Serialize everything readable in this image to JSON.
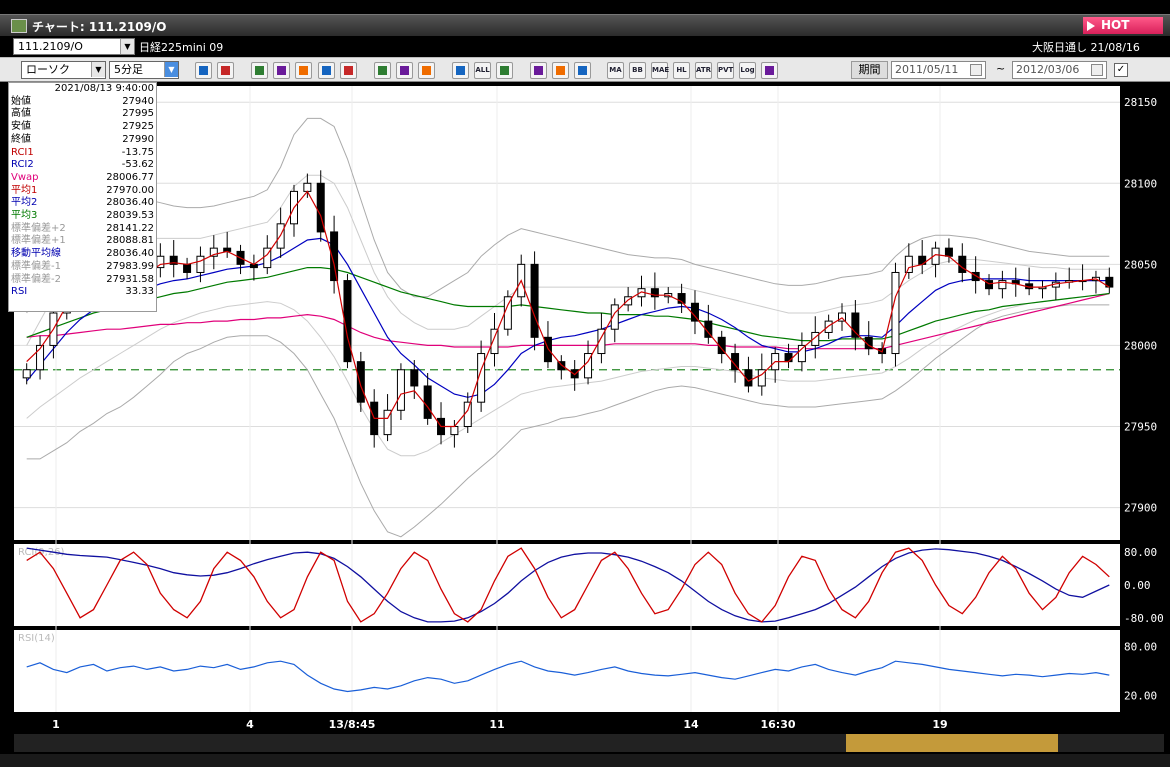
{
  "window": {
    "title": "チャート: 111.2109/O",
    "hot_label": "HOT"
  },
  "symbol_bar": {
    "symbol_code": "111.2109/O",
    "symbol_name": "日経225mini 09",
    "market_info": "大阪日通し  21/08/16"
  },
  "toolbar": {
    "chart_type": "ローソク",
    "interval": "5分足",
    "period_label": "期間",
    "date_from": "2011/05/11",
    "date_to": "2012/03/06",
    "tilde": "~",
    "icons": [
      "zoom-icon",
      "crosshair-icon",
      "down-arrow-icon",
      "zoom-in-icon",
      "grid-icon",
      "draw-icon",
      "pencil-icon",
      "cursor-icon",
      "pen-icon",
      "candle-icon",
      "candle-add-icon",
      "all-icon",
      "settings-icon",
      "brush-icon",
      "color-icon",
      "sma-icon",
      "ma-icon",
      "bb-icon",
      "mae-icon",
      "hl-icon",
      "atr-icon",
      "pivot-icon",
      "log-icon",
      "export-icon"
    ],
    "tb_labels": {
      "ma": "MA",
      "bb": "BB",
      "mae": "MAE",
      "hl": "HL",
      "atr": "ATR",
      "pvt": "PVT",
      "log": "Log",
      "all": "ALL"
    }
  },
  "info_panel": {
    "datetime": "2021/08/13 9:40:00",
    "rows": [
      {
        "label": "始値",
        "value": "27940",
        "color": "#000"
      },
      {
        "label": "高値",
        "value": "27995",
        "color": "#000"
      },
      {
        "label": "安値",
        "value": "27925",
        "color": "#000"
      },
      {
        "label": "終値",
        "value": "27990",
        "color": "#000"
      },
      {
        "label": "RCI1",
        "value": "-13.75",
        "color": "#c00000"
      },
      {
        "label": "RCI2",
        "value": "-53.62",
        "color": "#0000b0"
      },
      {
        "label": "Vwap",
        "value": "28006.77",
        "color": "#e0007a"
      },
      {
        "label": "平均1",
        "value": "27970.00",
        "color": "#c00000"
      },
      {
        "label": "平均2",
        "value": "28036.40",
        "color": "#0000b0"
      },
      {
        "label": "平均3",
        "value": "28039.53",
        "color": "#007a00"
      },
      {
        "label": "標準偏差+2",
        "value": "28141.22",
        "color": "#999"
      },
      {
        "label": "標準偏差+1",
        "value": "28088.81",
        "color": "#999"
      },
      {
        "label": "移動平均線",
        "value": "28036.40",
        "color": "#0000b0"
      },
      {
        "label": "標準偏差-1",
        "value": "27983.99",
        "color": "#999"
      },
      {
        "label": "標準偏差-2",
        "value": "27931.58",
        "color": "#999"
      },
      {
        "label": "RSI",
        "value": "33.33",
        "color": "#0000b0"
      }
    ]
  },
  "chart_data": [
    {
      "type": "candlestick",
      "y_ticks": [
        28150,
        28100,
        28050,
        28000,
        27950,
        27900
      ],
      "ylim": [
        27880,
        28160
      ],
      "reference_line": 27985,
      "x_labels": [
        "1",
        "4",
        "13/8:45",
        "11",
        "14",
        "16:30",
        "19"
      ],
      "close": [
        27985,
        28000,
        28020,
        28035,
        28040,
        28045,
        28040,
        28035,
        28040,
        28048,
        28055,
        28050,
        28045,
        28055,
        28060,
        28058,
        28050,
        28048,
        28060,
        28075,
        28095,
        28100,
        28070,
        28040,
        27990,
        27965,
        27945,
        27960,
        27985,
        27975,
        27955,
        27945,
        27950,
        27965,
        27995,
        28010,
        28030,
        28050,
        28005,
        27990,
        27985,
        27980,
        27995,
        28010,
        28025,
        28030,
        28035,
        28030,
        28032,
        28026,
        28015,
        28005,
        27995,
        27985,
        27975,
        27985,
        27995,
        27990,
        28000,
        28008,
        28015,
        28020,
        28005,
        27998,
        27995,
        28045,
        28055,
        28050,
        28060,
        28055,
        28045,
        28040,
        28035,
        28040,
        28038,
        28035,
        28036,
        28039,
        28040,
        28040,
        28042,
        28036
      ],
      "sma_red": [
        27990,
        27998,
        28010,
        28025,
        28035,
        28040,
        28042,
        28040,
        28040,
        28044,
        28050,
        28051,
        28050,
        28052,
        28056,
        28058,
        28054,
        28050,
        28056,
        28068,
        28085,
        28095,
        28080,
        28050,
        28005,
        27975,
        27955,
        27955,
        27970,
        27972,
        27962,
        27950,
        27950,
        27960,
        27985,
        28005,
        28025,
        28040,
        28018,
        27998,
        27988,
        27982,
        27990,
        28005,
        28020,
        28028,
        28033,
        28031,
        28031,
        28027,
        28018,
        28008,
        27998,
        27988,
        27978,
        27982,
        27990,
        27990,
        27998,
        28005,
        28012,
        28017,
        28008,
        28000,
        27996,
        28030,
        28048,
        28050,
        28056,
        28055,
        28048,
        28043,
        28038,
        28039,
        28038,
        28036,
        28036,
        28038,
        28039,
        28040,
        28041,
        28036
      ],
      "sma_blue": [
        27978,
        27988,
        27998,
        28008,
        28016,
        28022,
        28027,
        28030,
        28032,
        28035,
        28038,
        28040,
        28041,
        28043,
        28045,
        28047,
        28048,
        28049,
        28051,
        28055,
        28060,
        28065,
        28066,
        28062,
        28050,
        28035,
        28020,
        28005,
        27995,
        27988,
        27980,
        27975,
        27970,
        27968,
        27970,
        27976,
        27985,
        27995,
        28000,
        28003,
        28005,
        28006,
        28008,
        28010,
        28013,
        28016,
        28019,
        28021,
        28023,
        28024,
        28023,
        28020,
        28016,
        28011,
        28005,
        28000,
        27998,
        27996,
        27996,
        27998,
        28001,
        28005,
        28006,
        28006,
        28005,
        28012,
        28020,
        28027,
        28034,
        28038,
        28040,
        28041,
        28041,
        28041,
        28041,
        28040,
        28040,
        28040,
        28040,
        28040,
        28040,
        28040
      ],
      "sma_green": [
        28005,
        28008,
        28011,
        28014,
        28017,
        28020,
        28022,
        28024,
        28026,
        28028,
        28030,
        28032,
        28033,
        28035,
        28037,
        28039,
        28040,
        28041,
        28042,
        28044,
        28046,
        28048,
        28048,
        28047,
        28045,
        28042,
        28039,
        28036,
        28033,
        28031,
        28029,
        28027,
        28025,
        28024,
        28024,
        28024,
        28024,
        28025,
        28024,
        28023,
        28022,
        28021,
        28020,
        28020,
        28019,
        28019,
        28019,
        28018,
        28018,
        28017,
        28016,
        28014,
        28012,
        28010,
        28008,
        28006,
        28005,
        28004,
        28003,
        28003,
        28003,
        28004,
        28004,
        28004,
        28004,
        28006,
        28009,
        28012,
        28015,
        28017,
        28019,
        28021,
        28022,
        28024,
        28025,
        28026,
        28027,
        28028,
        28029,
        28030,
        28031,
        28032
      ],
      "vwap": [
        28005,
        28006,
        28006,
        28007,
        28008,
        28009,
        28010,
        28010,
        28011,
        28012,
        28013,
        28013,
        28014,
        28014,
        28015,
        28015,
        28016,
        28016,
        28017,
        28017,
        28018,
        28019,
        28018,
        28016,
        28012,
        28008,
        28005,
        28003,
        28002,
        28001,
        28000,
        28000,
        27999,
        27999,
        27999,
        27999,
        27999,
        28000,
        28000,
        28000,
        28000,
        28000,
        28000,
        28000,
        28001,
        28001,
        28001,
        28001,
        28001,
        28001,
        28001,
        28000,
        28000,
        27999,
        27999,
        27999,
        27999,
        27998,
        27998,
        27998,
        27998,
        27998,
        27998,
        27998,
        27998,
        28000,
        28002,
        28004,
        28006,
        28008,
        28010,
        28012,
        28014,
        28016,
        28018,
        28020,
        28022,
        28024,
        28026,
        28028,
        28030,
        28032
      ],
      "bb_upper2": [
        28020,
        28040,
        28060,
        28075,
        28085,
        28090,
        28092,
        28092,
        28090,
        28090,
        28088,
        28086,
        28085,
        28085,
        28086,
        28088,
        28090,
        28092,
        28096,
        28110,
        28130,
        28140,
        28140,
        28135,
        28115,
        28090,
        28065,
        28045,
        28035,
        28030,
        28030,
        28035,
        28040,
        28045,
        28055,
        28062,
        28068,
        28072,
        28070,
        28068,
        28066,
        28064,
        28062,
        28060,
        28058,
        28056,
        28055,
        28054,
        28054,
        28053,
        28050,
        28048,
        28046,
        28044,
        28042,
        28040,
        28038,
        28037,
        28037,
        28038,
        28040,
        28042,
        28043,
        28044,
        28046,
        28055,
        28062,
        28066,
        28068,
        28068,
        28067,
        28066,
        28064,
        28062,
        28060,
        28058,
        28057,
        28056,
        28055,
        28055,
        28055,
        28055
      ],
      "bb_lower2": [
        27930,
        27930,
        27935,
        27940,
        27947,
        27952,
        27958,
        27962,
        27968,
        27975,
        27982,
        27990,
        27995,
        27998,
        28002,
        28005,
        28006,
        28006,
        28006,
        28002,
        27995,
        27985,
        27970,
        27955,
        27935,
        27915,
        27898,
        27885,
        27882,
        27888,
        27895,
        27902,
        27910,
        27918,
        27925,
        27932,
        27940,
        27948,
        27950,
        27952,
        27955,
        27956,
        27958,
        27960,
        27963,
        27966,
        27969,
        27972,
        27974,
        27975,
        27974,
        27972,
        27970,
        27968,
        27966,
        27964,
        27963,
        27962,
        27962,
        27962,
        27963,
        27964,
        27965,
        27966,
        27967,
        27972,
        27978,
        27985,
        27992,
        27998,
        28004,
        28010,
        28015,
        28018,
        28020,
        28022,
        28023,
        28024,
        28025,
        28025,
        28025,
        28025
      ],
      "bb_upper1": [
        28000,
        28015,
        28030,
        28045,
        28055,
        28060,
        28064,
        28066,
        28066,
        28066,
        28066,
        28066,
        28066,
        28066,
        28068,
        28070,
        28072,
        28074,
        28076,
        28085,
        28098,
        28105,
        28105,
        28100,
        28085,
        28065,
        28045,
        28030,
        28020,
        28014,
        28010,
        28010,
        28010,
        28012,
        28018,
        28024,
        28030,
        28036,
        28036,
        28036,
        28036,
        28036,
        28036,
        28036,
        28036,
        28036,
        28036,
        28036,
        28036,
        28036,
        28034,
        28032,
        28030,
        28028,
        28026,
        28024,
        28022,
        28020,
        28020,
        28020,
        28022,
        28024,
        28025,
        28026,
        28028,
        28034,
        28040,
        28045,
        28050,
        28052,
        28053,
        28053,
        28052,
        28051,
        28050,
        28049,
        28048,
        28048,
        28047,
        28047,
        28047,
        28047
      ],
      "bb_lower1": [
        27955,
        27962,
        27968,
        27974,
        27980,
        27985,
        27990,
        27995,
        28000,
        28005,
        28010,
        28014,
        28017,
        28020,
        28022,
        28024,
        28025,
        28026,
        28027,
        28026,
        28022,
        28015,
        28005,
        27993,
        27978,
        27962,
        27948,
        27936,
        27932,
        27932,
        27935,
        27940,
        27945,
        27950,
        27955,
        27960,
        27965,
        27970,
        27972,
        27974,
        27975,
        27976,
        27977,
        27978,
        27980,
        27982,
        27984,
        27985,
        27986,
        27987,
        27987,
        27986,
        27985,
        27984,
        27982,
        27980,
        27979,
        27978,
        27978,
        27978,
        27979,
        27980,
        27981,
        27982,
        27983,
        27987,
        27992,
        27998,
        28003,
        28008,
        28012,
        28016,
        28019,
        28022,
        28024,
        28026,
        28027,
        28028,
        28029,
        28030,
        28031,
        28032
      ]
    },
    {
      "type": "line",
      "indicator": "RCI(9,26)",
      "y_ticks": [
        80,
        0,
        -80
      ],
      "ylim": [
        -100,
        100
      ],
      "rci1": [
        60,
        80,
        40,
        -20,
        -80,
        -60,
        0,
        60,
        80,
        50,
        -20,
        -60,
        -80,
        -40,
        40,
        80,
        60,
        20,
        -40,
        -80,
        -60,
        20,
        80,
        60,
        -40,
        -90,
        -70,
        -20,
        40,
        80,
        60,
        -10,
        -70,
        -90,
        -60,
        10,
        70,
        90,
        40,
        -30,
        -80,
        -60,
        0,
        60,
        80,
        40,
        -20,
        -70,
        -60,
        -10,
        50,
        80,
        50,
        -20,
        -70,
        -90,
        -50,
        20,
        70,
        60,
        -10,
        -60,
        -80,
        -40,
        30,
        80,
        90,
        60,
        0,
        -50,
        -70,
        -30,
        30,
        70,
        40,
        -20,
        -60,
        -30,
        30,
        70,
        50,
        20
      ],
      "rci2": [
        90,
        85,
        80,
        75,
        72,
        70,
        68,
        62,
        55,
        48,
        40,
        30,
        25,
        22,
        24,
        30,
        40,
        52,
        62,
        70,
        78,
        80,
        76,
        65,
        45,
        20,
        -10,
        -40,
        -65,
        -80,
        -90,
        -90,
        -88,
        -80,
        -65,
        -45,
        -20,
        10,
        35,
        55,
        68,
        75,
        78,
        78,
        74,
        68,
        58,
        45,
        30,
        10,
        -15,
        -40,
        -60,
        -75,
        -85,
        -90,
        -88,
        -80,
        -70,
        -60,
        -45,
        -25,
        -5,
        20,
        45,
        65,
        78,
        85,
        88,
        86,
        82,
        78,
        70,
        60,
        45,
        28,
        10,
        -10,
        -25,
        -30,
        -15,
        0
      ]
    },
    {
      "type": "line",
      "indicator": "RSI(14)",
      "y_ticks": [
        80,
        20
      ],
      "ylim": [
        0,
        100
      ],
      "rsi": [
        55,
        60,
        52,
        48,
        55,
        58,
        50,
        54,
        56,
        52,
        55,
        50,
        52,
        56,
        54,
        58,
        52,
        55,
        60,
        62,
        58,
        45,
        35,
        28,
        25,
        27,
        30,
        28,
        32,
        38,
        42,
        40,
        35,
        38,
        45,
        52,
        58,
        62,
        55,
        50,
        48,
        45,
        48,
        52,
        55,
        50,
        47,
        45,
        44,
        46,
        48,
        45,
        42,
        40,
        44,
        48,
        52,
        50,
        55,
        58,
        52,
        48,
        45,
        50,
        54,
        62,
        60,
        58,
        55,
        52,
        50,
        48,
        46,
        44,
        46,
        45,
        43,
        45,
        47,
        46,
        48,
        45
      ]
    }
  ]
}
